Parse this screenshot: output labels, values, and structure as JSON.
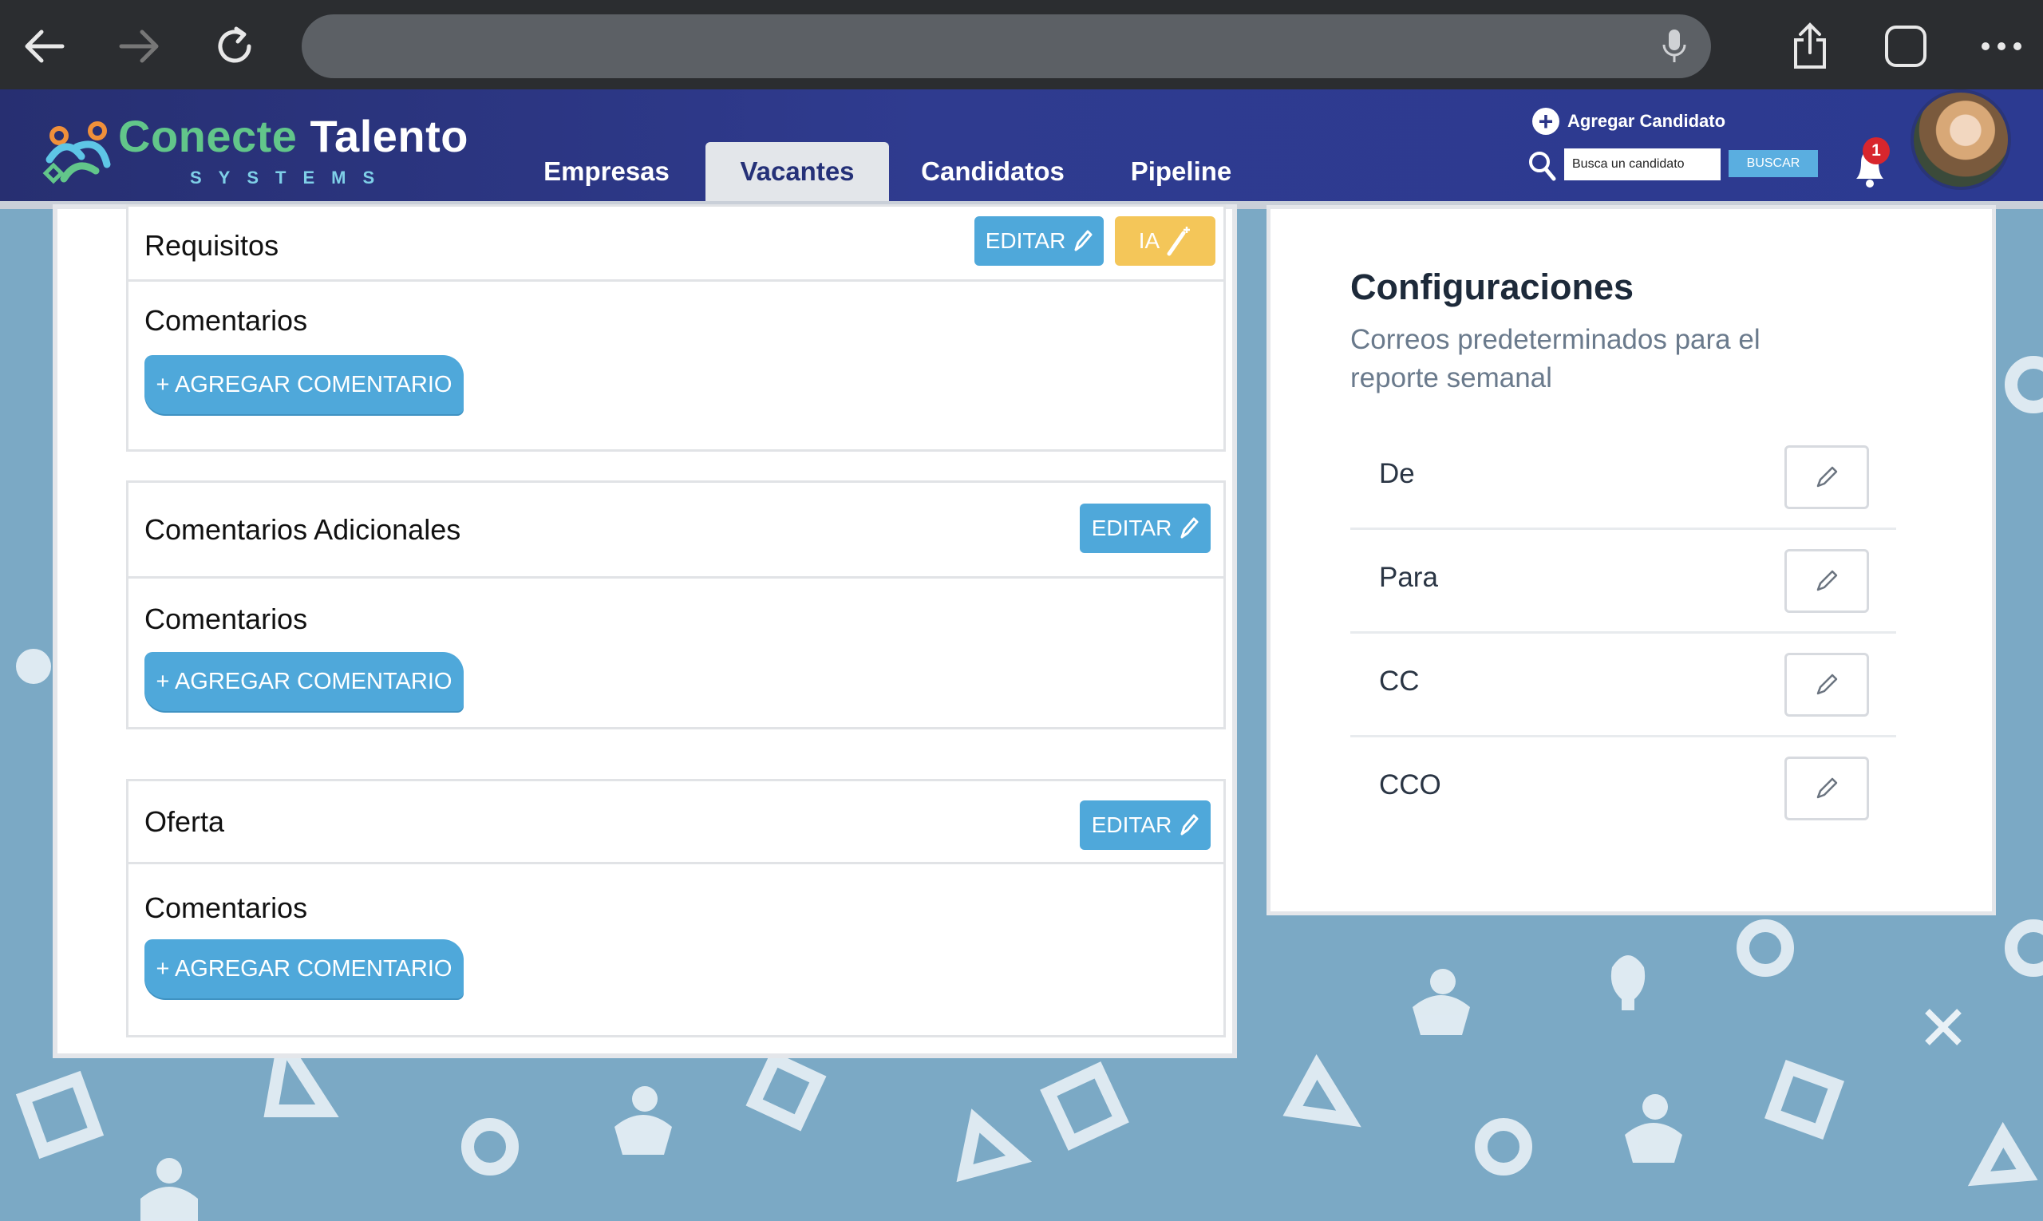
{
  "browser": {
    "icons": [
      "back-arrow-icon",
      "forward-arrow-icon",
      "reload-icon",
      "microphone-icon",
      "share-icon",
      "tabs-icon",
      "more-icon"
    ]
  },
  "header": {
    "logo_word1": "Conecte",
    "logo_word2": "Talento",
    "logo_sub": "SYSTEMS",
    "nav": [
      "Empresas",
      "Vacantes",
      "Candidatos",
      "Pipeline"
    ],
    "active_nav": "Vacantes",
    "add_candidate": "Agregar Candidato",
    "search_placeholder": "Busca un candidato",
    "search_button": "BUSCAR",
    "notification_count": "1",
    "colors": {
      "header_start": "#272f71",
      "header_end": "#2c3a91",
      "accent_green": "#62c68a"
    }
  },
  "sections": [
    {
      "title": "Requisitos",
      "edit_label": "EDITAR",
      "ai_label": "IA",
      "comments_label": "Comentarios",
      "add_comment_label": "+ AGREGAR COMENTARIO"
    },
    {
      "title": "Comentarios Adicionales",
      "edit_label": "EDITAR",
      "comments_label": "Comentarios",
      "add_comment_label": "+ AGREGAR COMENTARIO"
    },
    {
      "title": "Oferta",
      "edit_label": "EDITAR",
      "comments_label": "Comentarios",
      "add_comment_label": "+ AGREGAR COMENTARIO"
    }
  ],
  "config": {
    "title": "Configuraciones",
    "subtitle": "Correos predeterminados para el reporte semanal",
    "rows": [
      "De",
      "Para",
      "CC",
      "CCO"
    ]
  },
  "colors": {
    "button_blue": "#4fa8da",
    "button_yellow": "#f4c659",
    "background": "#7ba9c5"
  }
}
